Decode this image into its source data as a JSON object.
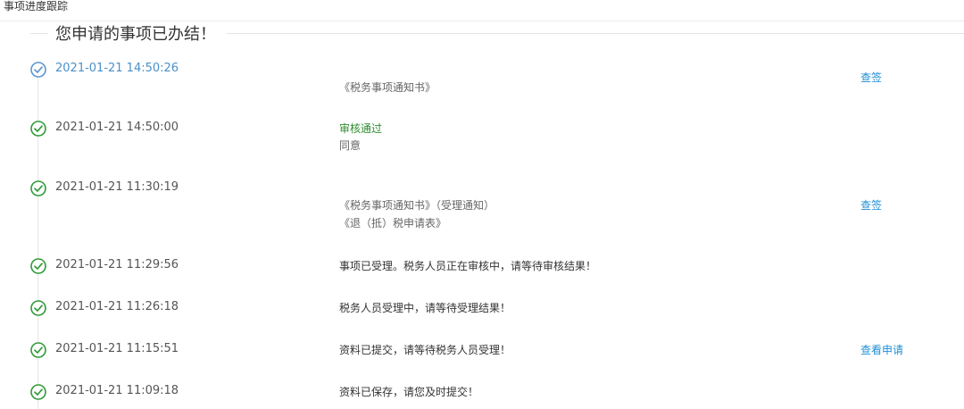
{
  "header": {
    "title": "事项进度跟踪"
  },
  "banner": {
    "title": "您申请的事项已办结！"
  },
  "colors": {
    "check_green": "#2e9a36",
    "check_blue": "#5a96d0",
    "link": "#1f8fd6",
    "approved": "#2e8b2e"
  },
  "timeline": [
    {
      "icon": "check-circle-blue-icon",
      "time": "2021-01-21 14:50:26",
      "lines": [
        "《税务事项通知书》"
      ],
      "action": "查签"
    },
    {
      "icon": "check-circle-green-icon",
      "time": "2021-01-21 14:50:00",
      "lines": [
        "审核通过",
        "同意"
      ]
    },
    {
      "icon": "check-circle-green-icon",
      "time": "2021-01-21 11:30:19",
      "lines": [
        "《税务事项通知书》（受理通知）",
        "《退（抵）税申请表》"
      ],
      "action": "查签"
    },
    {
      "icon": "check-circle-green-icon",
      "time": "2021-01-21 11:29:56",
      "lines": [
        "事项已受理。税务人员正在审核中，请等待审核结果！"
      ]
    },
    {
      "icon": "check-circle-green-icon",
      "time": "2021-01-21 11:26:18",
      "lines": [
        "税务人员受理中，请等待受理结果！"
      ]
    },
    {
      "icon": "check-circle-green-icon",
      "time": "2021-01-21 11:15:51",
      "lines": [
        "资料已提交，请等待税务人员受理！"
      ],
      "action": "查看申请"
    },
    {
      "icon": "check-circle-green-icon",
      "time": "2021-01-21 11:09:18",
      "lines": [
        "资料已保存，请您及时提交！"
      ]
    }
  ]
}
